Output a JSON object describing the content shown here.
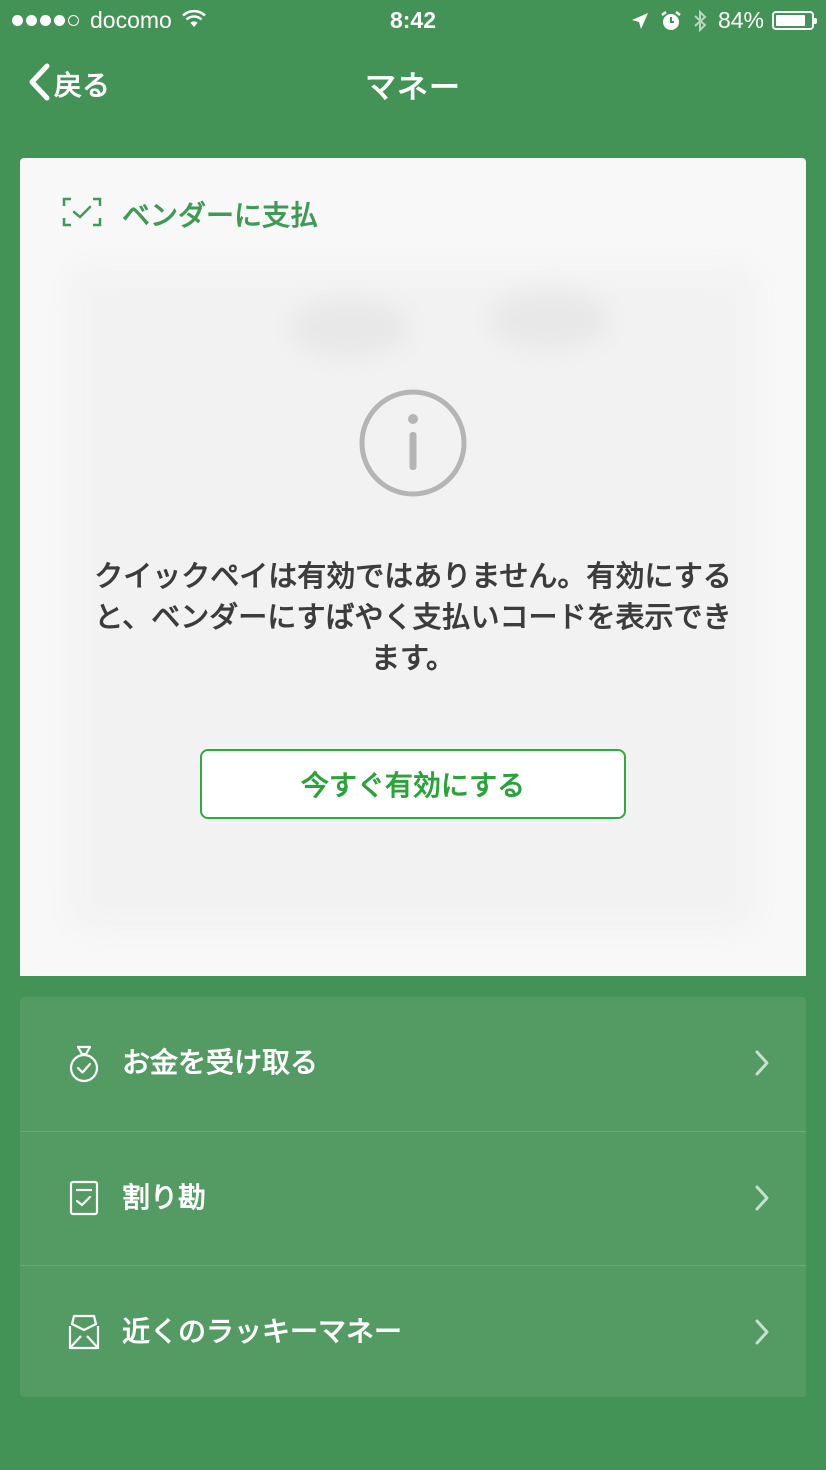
{
  "status_bar": {
    "carrier": "docomo",
    "time": "8:42",
    "battery_percent": "84%",
    "battery_level": 0.84,
    "signal_bars_filled": 4,
    "signal_bars_total": 5
  },
  "nav": {
    "back_label": "戻る",
    "title": "マネー"
  },
  "pay_card": {
    "header_label": "ベンダーに支払",
    "notice_text": "クイックペイは有効ではありません。有効にすると、ベンダーにすばやく支払いコードを表示できます。",
    "enable_button_label": "今すぐ有効にする"
  },
  "menu": {
    "items": [
      {
        "label": "お金を受け取る",
        "icon": "money-bag-icon"
      },
      {
        "label": "割り勘",
        "icon": "bill-split-icon"
      },
      {
        "label": "近くのラッキーマネー",
        "icon": "red-envelope-icon"
      }
    ]
  },
  "colors": {
    "background": "#439357",
    "accent_green": "#2faa3c",
    "header_green": "#3f9a55",
    "menu_background": "#539a63"
  }
}
